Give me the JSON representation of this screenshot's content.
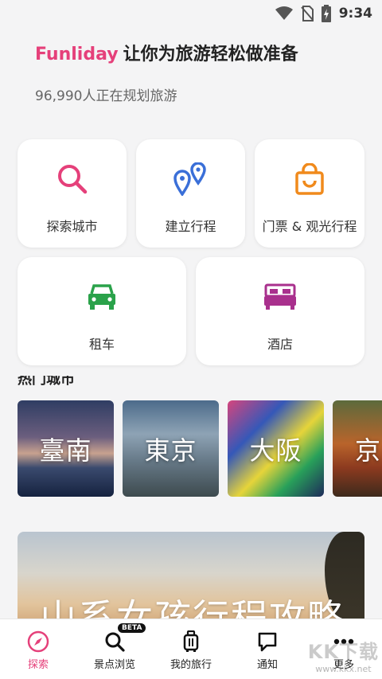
{
  "status_bar": {
    "time": "9:34"
  },
  "hero": {
    "brand": "Funliday",
    "title": "让你为旅游轻松做准备",
    "subtitle": "96,990人正在规划旅游"
  },
  "quick_actions": [
    {
      "label": "探索城市",
      "icon": "search-icon",
      "color": "#e5407a"
    },
    {
      "label": "建立行程",
      "icon": "map-pins-icon",
      "color": "#3a6fd8"
    },
    {
      "label": "门票 & 观光行程",
      "icon": "shopping-bag-icon",
      "color": "#f08a1c"
    },
    {
      "label": "租车",
      "icon": "car-icon",
      "color": "#2aa24a"
    },
    {
      "label": "酒店",
      "icon": "bed-icon",
      "color": "#a9308d"
    }
  ],
  "popular_cities": {
    "title": "热门城市",
    "cities": [
      "臺南",
      "東京",
      "大阪",
      "京"
    ]
  },
  "banner": {
    "text": "山系女孩行程攻略"
  },
  "bottom_nav": {
    "items": [
      {
        "label": "探索",
        "icon": "compass-icon"
      },
      {
        "label": "景点浏览",
        "icon": "search-icon",
        "badge": "BETA"
      },
      {
        "label": "我的旅行",
        "icon": "suitcase-icon"
      },
      {
        "label": "通知",
        "icon": "chat-bubble-icon"
      },
      {
        "label": "更多",
        "icon": "more-dots-icon"
      }
    ],
    "active_color": "#e5407a"
  },
  "watermark": {
    "big": "KK下载",
    "small": "www.kkx.net"
  }
}
